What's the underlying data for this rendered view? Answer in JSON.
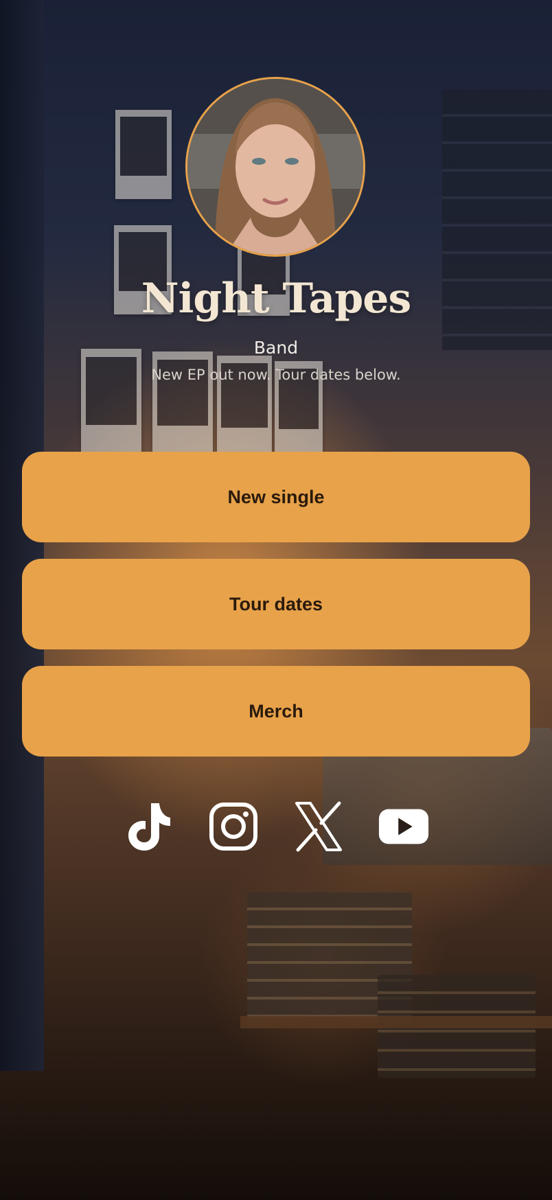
{
  "profile": {
    "name": "Night Tapes",
    "category": "Band",
    "tagline": "New EP out now. Tour dates below."
  },
  "links": [
    {
      "label": "New single"
    },
    {
      "label": "Tour dates"
    },
    {
      "label": "Merch"
    }
  ],
  "socials": [
    {
      "name": "TikTok",
      "icon": "tiktok-icon"
    },
    {
      "name": "Instagram",
      "icon": "instagram-icon"
    },
    {
      "name": "X",
      "icon": "x-icon"
    },
    {
      "name": "YouTube",
      "icon": "youtube-icon"
    }
  ],
  "colors": {
    "accent": "#e8a24a",
    "button_text": "#2a1a0c",
    "title": "#f3e7d3"
  }
}
